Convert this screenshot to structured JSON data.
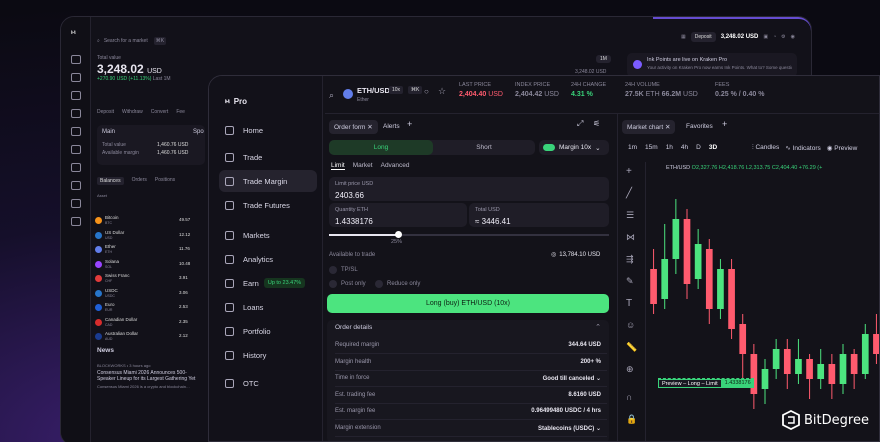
{
  "back": {
    "search_placeholder": "Search for a market",
    "search_kbd": "⌘K",
    "deposit": "Deposit",
    "balance": "3,248.02 USD",
    "total_label": "Total value",
    "total_value": "3,248.02",
    "total_ccy": "USD",
    "total_change": "+270.90 USD (+11.13%)",
    "total_change_suffix": "Last 1M",
    "range": "1M",
    "chart_value": "3,248.02 USD",
    "actions": [
      "Deposit",
      "Withdraw",
      "Convert",
      "Fee"
    ],
    "main_label": "Main",
    "spot_label": "Spo",
    "main_rows": [
      {
        "k": "Total value",
        "v": "1,460.76 USD"
      },
      {
        "k": "Available margin",
        "v": "1,460.76 USD"
      }
    ],
    "tabs": [
      "Balances",
      "Orders",
      "Positions"
    ],
    "asset_header": "Asset",
    "assets": [
      {
        "name": "Bitcoin",
        "sym": "BTC",
        "v": "49.57",
        "c": "#f7931a"
      },
      {
        "name": "US Dollar",
        "sym": "USD",
        "v": "12.12",
        "c": "#2775ca"
      },
      {
        "name": "Ether",
        "sym": "ETH",
        "v": "11.76",
        "c": "#627eea"
      },
      {
        "name": "Solana",
        "sym": "SOL",
        "v": "10.48",
        "c": "#9945ff"
      },
      {
        "name": "Swiss Franc",
        "sym": "CHF",
        "v": "3.91",
        "c": "#e23b3b"
      },
      {
        "name": "USDC",
        "sym": "USDC",
        "v": "3.06",
        "c": "#2775ca"
      },
      {
        "name": "Euro",
        "sym": "EUR",
        "v": "2.53",
        "c": "#1f5fd6"
      },
      {
        "name": "Canadian Dollar",
        "sym": "CAD",
        "v": "2.35",
        "c": "#d62c2c"
      },
      {
        "name": "Australian Dollar",
        "sym": "AUD",
        "v": "2.12",
        "c": "#1a3b8f"
      }
    ],
    "news_title": "News",
    "news_meta": "BLOCKWORKS • 3 hours ago",
    "news_headline": "Consensus Miami 2026 Announces 500-Speaker Lineup for its Largest Gathering Yet",
    "news_body": "Consensus Miami 2026 is a crypto and blockchain…",
    "ink_title": "Ink Points are live on Kraken Pro",
    "ink_body": "Your activity on Kraken Pro now earns Ink Points. What to? Some question"
  },
  "app": {
    "logo": "Pro",
    "nav": [
      {
        "l": "Home"
      },
      {
        "l": "Trade"
      },
      {
        "l": "Trade Margin"
      },
      {
        "l": "Trade Futures"
      },
      {
        "l": "Markets"
      },
      {
        "l": "Analytics"
      },
      {
        "l": "Earn"
      },
      {
        "l": "Loans"
      },
      {
        "l": "Portfolio"
      },
      {
        "l": "History"
      },
      {
        "l": "OTC"
      }
    ],
    "earn_badge": "Up to 23.47%"
  },
  "ticker": {
    "pair": "ETH/USD",
    "name": "Ether",
    "lev": "10x",
    "kbd": "⌘K",
    "last_label": "LAST PRICE",
    "last": "2,404.40",
    "last_ccy": "USD",
    "index_label": "INDEX PRICE",
    "index": "2,404.42",
    "index_ccy": "USD",
    "chg_label": "24H CHANGE",
    "chg": "4.31 %",
    "vol_label": "24H VOLUME",
    "vol1": "27.5K",
    "vol1_ccy": "ETH",
    "vol2": "66.2M",
    "vol2_ccy": "USD",
    "fees_label": "FEES",
    "fees": "0.25 % / 0.40 %"
  },
  "order": {
    "tab1": "Order form",
    "tab2": "Alerts",
    "long": "Long",
    "short": "Short",
    "margin": "Margin 10x",
    "types": [
      "Limit",
      "Market",
      "Advanced"
    ],
    "limit_label": "Limit price USD",
    "limit_value": "2403.66",
    "qty_label": "Quantity ETH",
    "qty_value": "1.4338176",
    "total_label": "Total USD",
    "total_value": "≈ 3446.41",
    "slider_pct": "25%",
    "avail_label": "Available to trade",
    "avail_value": "13,784.10 USD",
    "tpsl": "TP/SL",
    "post": "Post only",
    "reduce": "Reduce only",
    "submit": "Long (buy) ETH/USD (10x)",
    "details_title": "Order details",
    "details": [
      {
        "k": "Required margin",
        "v": "344.64 USD"
      },
      {
        "k": "Margin health",
        "v": "200+ %"
      },
      {
        "k": "Time in force",
        "v": "Good till canceled"
      },
      {
        "k": "Est. trading fee",
        "v": "8.6160 USD"
      },
      {
        "k": "Est. margin fee",
        "v": "0.96499480 USDC / 4 hrs"
      },
      {
        "k": "Margin extension",
        "v": "Stablecoins (USDC)"
      }
    ]
  },
  "chart": {
    "tab1": "Market chart",
    "tab2": "Favorites",
    "intervals": [
      "1m",
      "15m",
      "1h",
      "4h",
      "D",
      "3D"
    ],
    "candles": "Candles",
    "indicators": "Indicators",
    "preview": "Preview",
    "ohlc_pair": "ETH/USD",
    "o": "2,327.76",
    "h": "2,418.76",
    "l": "2,313.75",
    "c": "2,404.40",
    "chg": "+76.29 (+",
    "preview_tag": "Preview – Long – Limit",
    "preview_qty": "1.4338176"
  },
  "chart_data": {
    "type": "candlestick",
    "candles": [
      {
        "o": 0.62,
        "c": 0.48,
        "h": 0.7,
        "l": 0.44
      },
      {
        "o": 0.5,
        "c": 0.66,
        "h": 0.8,
        "l": 0.46
      },
      {
        "o": 0.66,
        "c": 0.82,
        "h": 0.9,
        "l": 0.6
      },
      {
        "o": 0.82,
        "c": 0.56,
        "h": 0.86,
        "l": 0.5
      },
      {
        "o": 0.58,
        "c": 0.72,
        "h": 0.78,
        "l": 0.54
      },
      {
        "o": 0.7,
        "c": 0.46,
        "h": 0.74,
        "l": 0.4
      },
      {
        "o": 0.46,
        "c": 0.62,
        "h": 0.66,
        "l": 0.42
      },
      {
        "o": 0.62,
        "c": 0.38,
        "h": 0.66,
        "l": 0.34
      },
      {
        "o": 0.4,
        "c": 0.28,
        "h": 0.44,
        "l": 0.16
      },
      {
        "o": 0.28,
        "c": 0.12,
        "h": 0.32,
        "l": 0.06
      },
      {
        "o": 0.14,
        "c": 0.22,
        "h": 0.26,
        "l": 0.08
      },
      {
        "o": 0.22,
        "c": 0.3,
        "h": 0.34,
        "l": 0.18
      },
      {
        "o": 0.3,
        "c": 0.2,
        "h": 0.34,
        "l": 0.14
      },
      {
        "o": 0.2,
        "c": 0.26,
        "h": 0.34,
        "l": 0.16
      },
      {
        "o": 0.26,
        "c": 0.18,
        "h": 0.28,
        "l": 0.1
      },
      {
        "o": 0.18,
        "c": 0.24,
        "h": 0.3,
        "l": 0.14
      },
      {
        "o": 0.24,
        "c": 0.16,
        "h": 0.28,
        "l": 0.1
      },
      {
        "o": 0.16,
        "c": 0.28,
        "h": 0.32,
        "l": 0.12
      },
      {
        "o": 0.28,
        "c": 0.2,
        "h": 0.3,
        "l": 0.14
      },
      {
        "o": 0.2,
        "c": 0.36,
        "h": 0.4,
        "l": 0.18
      },
      {
        "o": 0.36,
        "c": 0.28,
        "h": 0.44,
        "l": 0.24
      }
    ]
  }
}
